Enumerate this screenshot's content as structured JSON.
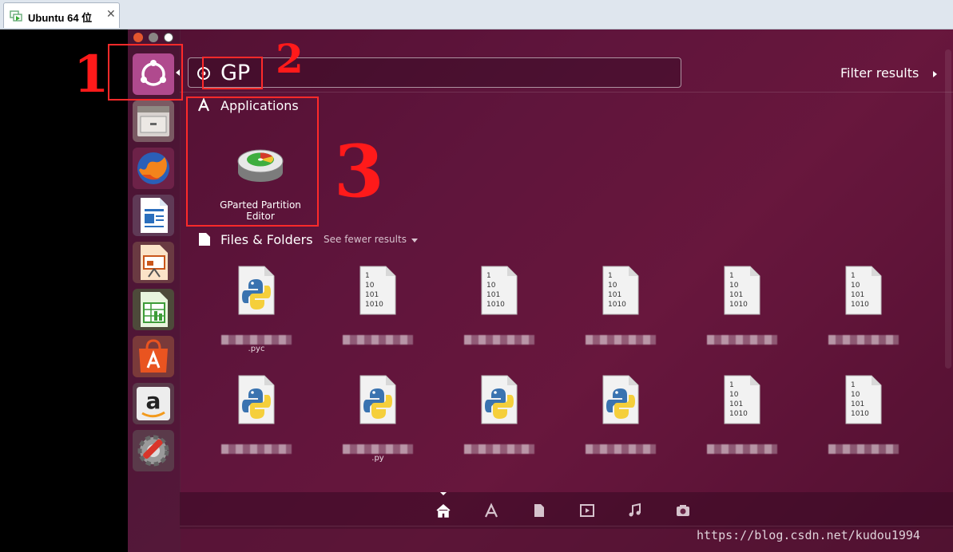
{
  "host": {
    "tab_title": "Ubuntu 64 位",
    "close_glyph": "✕"
  },
  "dash": {
    "search_value": "GP",
    "filter_results_label": "Filter results",
    "applications_header": "Applications",
    "files_header": "Files & Folders",
    "see_fewer_label": "See fewer results",
    "app_result": {
      "label": "GParted Partition Editor",
      "icon": "gparted-disk-icon"
    },
    "file_results": [
      {
        "icon": "python-file-icon",
        "caption": ".pyc"
      },
      {
        "icon": "binary-file-icon",
        "caption": ""
      },
      {
        "icon": "binary-file-icon",
        "caption": ""
      },
      {
        "icon": "binary-file-icon",
        "caption": ""
      },
      {
        "icon": "binary-file-icon",
        "caption": ""
      },
      {
        "icon": "binary-file-icon",
        "caption": ""
      },
      {
        "icon": "python-file-icon",
        "caption": ""
      },
      {
        "icon": "python-file-icon",
        "caption": ".py"
      },
      {
        "icon": "python-file-icon",
        "caption": ""
      },
      {
        "icon": "python-file-icon",
        "caption": ""
      },
      {
        "icon": "binary-file-icon",
        "caption": ""
      },
      {
        "icon": "binary-file-icon",
        "caption": ""
      }
    ],
    "binary_file_text": [
      "1",
      "10",
      "101",
      "1010"
    ],
    "filter_lenses": [
      "home-icon",
      "applications-icon",
      "files-icon",
      "video-icon",
      "music-icon",
      "photo-icon"
    ]
  },
  "launcher": {
    "items": [
      "ubuntu-dash-icon",
      "files-cabinet-icon",
      "firefox-icon",
      "libreoffice-writer-icon",
      "libreoffice-impress-icon",
      "libreoffice-calc-icon",
      "software-center-icon",
      "amazon-icon",
      "system-settings-icon"
    ]
  },
  "annotations": [
    "1",
    "2",
    "3"
  ],
  "watermark": "https://blog.csdn.net/kudou1994",
  "colors": {
    "annotation_red": "#ff2a2a",
    "ubuntu_orange": "#e95420"
  }
}
